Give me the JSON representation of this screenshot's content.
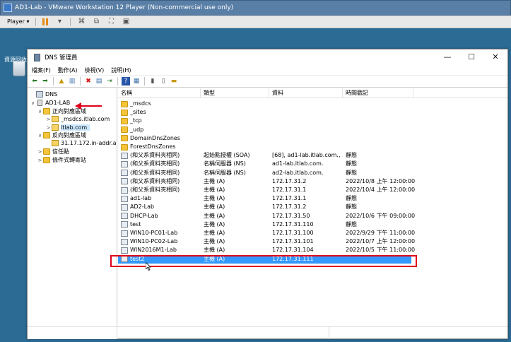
{
  "vm": {
    "title": "AD1-Lab - VMware Workstation 12 Player (Non-commercial use only)",
    "player_label": "Player",
    "colors": {
      "pause": "#e28a1b",
      "desktop": "#2b6b94"
    }
  },
  "desktop": {
    "recycle_label": "資源回收"
  },
  "dns": {
    "title": "DNS 管理員",
    "menu": [
      "檔案(F)",
      "動作(A)",
      "檢視(V)",
      "說明(H)"
    ],
    "tree": [
      {
        "label": "DNS",
        "indent": 0,
        "icon": "computer-icon",
        "toggle": ""
      },
      {
        "label": "AD1-LAB",
        "indent": 1,
        "icon": "server-icon",
        "toggle": "∨"
      },
      {
        "label": "正向對應區域",
        "indent": 2,
        "icon": "folder-icon",
        "toggle": "∨"
      },
      {
        "label": "_msdcs.itlab.com",
        "indent": 3,
        "icon": "zone-icon",
        "toggle": ">"
      },
      {
        "label": "itlab.com",
        "indent": 3,
        "icon": "zone-icon",
        "toggle": ">",
        "selected": true
      },
      {
        "label": "反向對應區域",
        "indent": 2,
        "icon": "folder-icon",
        "toggle": "∨"
      },
      {
        "label": "31.17.172.in-addr.a",
        "indent": 3,
        "icon": "zone-icon",
        "toggle": ""
      },
      {
        "label": "信任點",
        "indent": 2,
        "icon": "folder-icon",
        "toggle": ">"
      },
      {
        "label": "條件式轉寄站",
        "indent": 2,
        "icon": "folder-icon",
        "toggle": ">"
      }
    ],
    "columns": [
      "名稱",
      "類型",
      "資料",
      "時間戳記"
    ],
    "rows": [
      {
        "name": "_msdcs",
        "type": "",
        "data": "",
        "ts": "",
        "icon": "folder"
      },
      {
        "name": "_sites",
        "type": "",
        "data": "",
        "ts": "",
        "icon": "folder"
      },
      {
        "name": "_tcp",
        "type": "",
        "data": "",
        "ts": "",
        "icon": "folder"
      },
      {
        "name": "_udp",
        "type": "",
        "data": "",
        "ts": "",
        "icon": "folder"
      },
      {
        "name": "DomainDnsZones",
        "type": "",
        "data": "",
        "ts": "",
        "icon": "folder"
      },
      {
        "name": "ForestDnsZones",
        "type": "",
        "data": "",
        "ts": "",
        "icon": "folder"
      },
      {
        "name": "(和父系資料夾相同)",
        "type": "起始點授權 (SOA)",
        "data": "[68], ad1-lab.itlab.com., ...",
        "ts": "靜態",
        "icon": "rec"
      },
      {
        "name": "(和父系資料夾相同)",
        "type": "名稱伺服器 (NS)",
        "data": "ad1-lab.itlab.com.",
        "ts": "靜態",
        "icon": "rec"
      },
      {
        "name": "(和父系資料夾相同)",
        "type": "名稱伺服器 (NS)",
        "data": "ad2-lab.itlab.com.",
        "ts": "靜態",
        "icon": "rec"
      },
      {
        "name": "(和父系資料夾相同)",
        "type": "主機 (A)",
        "data": "172.17.31.2",
        "ts": "2022/10/8 上午 12:00:00",
        "icon": "rec"
      },
      {
        "name": "(和父系資料夾相同)",
        "type": "主機 (A)",
        "data": "172.17.31.1",
        "ts": "2022/10/4 上午 12:00:00",
        "icon": "rec"
      },
      {
        "name": "ad1-lab",
        "type": "主機 (A)",
        "data": "172.17.31.1",
        "ts": "靜態",
        "icon": "rec"
      },
      {
        "name": "AD2-Lab",
        "type": "主機 (A)",
        "data": "172.17.31.2",
        "ts": "靜態",
        "icon": "rec"
      },
      {
        "name": "DHCP-Lab",
        "type": "主機 (A)",
        "data": "172.17.31.50",
        "ts": "2022/10/6 下午 09:00:00",
        "icon": "rec"
      },
      {
        "name": "test",
        "type": "主機 (A)",
        "data": "172.17.31.110",
        "ts": "靜態",
        "icon": "rec"
      },
      {
        "name": "WIN10-PC01-Lab",
        "type": "主機 (A)",
        "data": "172.17.31.100",
        "ts": "2022/9/29 下午 11:00:00",
        "icon": "rec"
      },
      {
        "name": "WIN10-PC02-Lab",
        "type": "主機 (A)",
        "data": "172.17.31.101",
        "ts": "2022/10/7 上午 12:00:00",
        "icon": "rec"
      },
      {
        "name": "WIN2016M1-Lab",
        "type": "主機 (A)",
        "data": "172.17.31.104",
        "ts": "2022/10/5 下午 11:00:00",
        "icon": "rec"
      },
      {
        "name": "test2",
        "type": "主機 (A)",
        "data": "172.17.31.111",
        "ts": "",
        "icon": "rec",
        "selected": true
      }
    ],
    "colors": {
      "selection": "#3399ff",
      "highlight_box": "#e0001b",
      "arrow": "#e0001b",
      "folder": "#f5c43b"
    }
  }
}
